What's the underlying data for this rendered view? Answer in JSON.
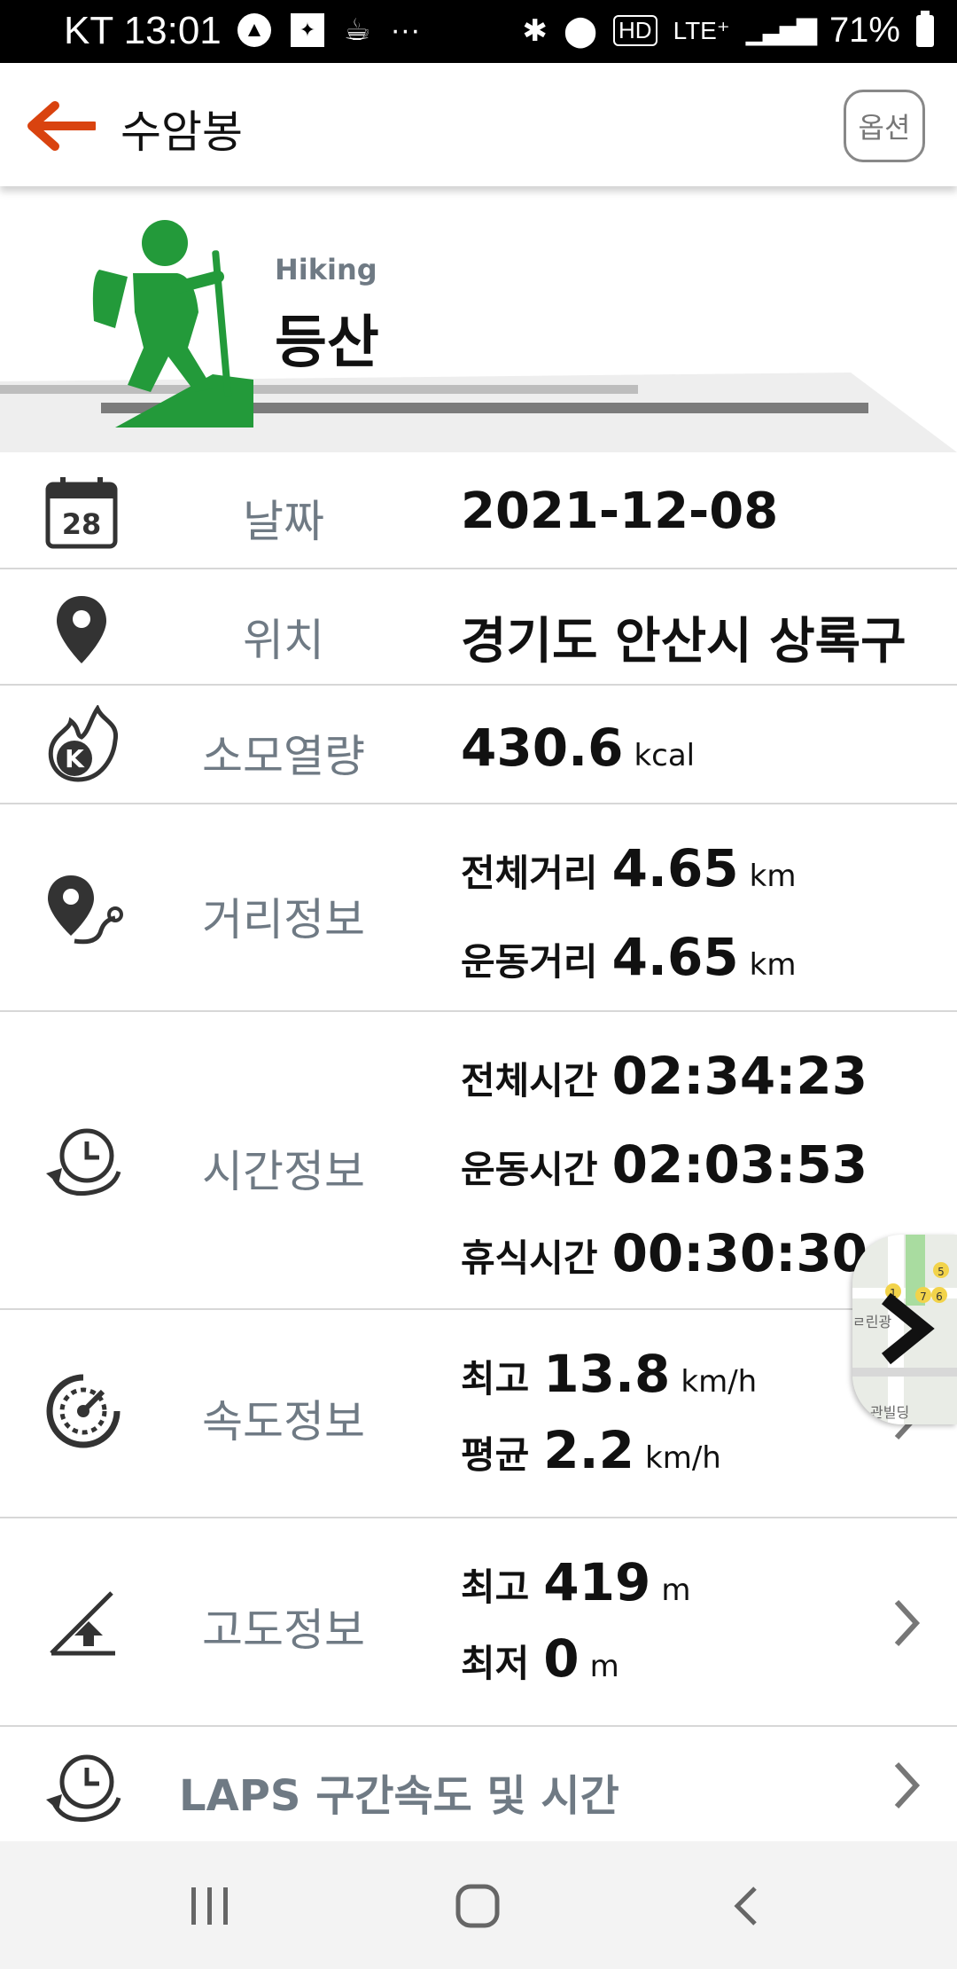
{
  "status_bar": {
    "carrier_time": "KT 13:01",
    "notification_icons": [
      "navigation-icon",
      "app-icon",
      "coffee-icon",
      "more-icon"
    ],
    "more": "···",
    "hd": "HD",
    "lte": "LTE⁺",
    "battery": "71%"
  },
  "app_bar": {
    "title": "수암봉",
    "option_label": "옵션",
    "accent_color": "#d9430f"
  },
  "activity": {
    "subtitle": "Hiking",
    "title": "등산",
    "icon_color": "#239a3a"
  },
  "rows": {
    "date": {
      "label": "날짜",
      "value": "2021-12-08",
      "icon_text": "28"
    },
    "location": {
      "label": "위치",
      "value": "경기도 안산시 상록구"
    },
    "calories": {
      "label": "소모열량",
      "value": "430.6",
      "unit": "kcal",
      "icon_text": "K"
    },
    "distance": {
      "label": "거리정보",
      "lines": [
        {
          "key": "전체거리",
          "value": "4.65",
          "unit": "km"
        },
        {
          "key": "운동거리",
          "value": "4.65",
          "unit": "km"
        }
      ]
    },
    "time": {
      "label": "시간정보",
      "lines": [
        {
          "key": "전체시간",
          "value": "02:34:23"
        },
        {
          "key": "운동시간",
          "value": "02:03:53"
        },
        {
          "key": "휴식시간",
          "value": "00:30:30"
        }
      ]
    },
    "speed": {
      "label": "속도정보",
      "lines": [
        {
          "key": "최고",
          "value": "13.8",
          "unit": "km/h"
        },
        {
          "key": "평균",
          "value": "2.2",
          "unit": "km/h"
        }
      ]
    },
    "altitude": {
      "label": "고도정보",
      "lines": [
        {
          "key": "최고",
          "value": "419",
          "unit": "m"
        },
        {
          "key": "최저",
          "value": "0",
          "unit": "m"
        }
      ]
    },
    "laps": {
      "label": "LAPS 구간속도 및 시간"
    }
  },
  "map_thumb": {
    "text_top": "ㄹ린광",
    "text_bottom": "관빌딩",
    "markers": [
      "5",
      "1",
      "7",
      "6"
    ]
  }
}
